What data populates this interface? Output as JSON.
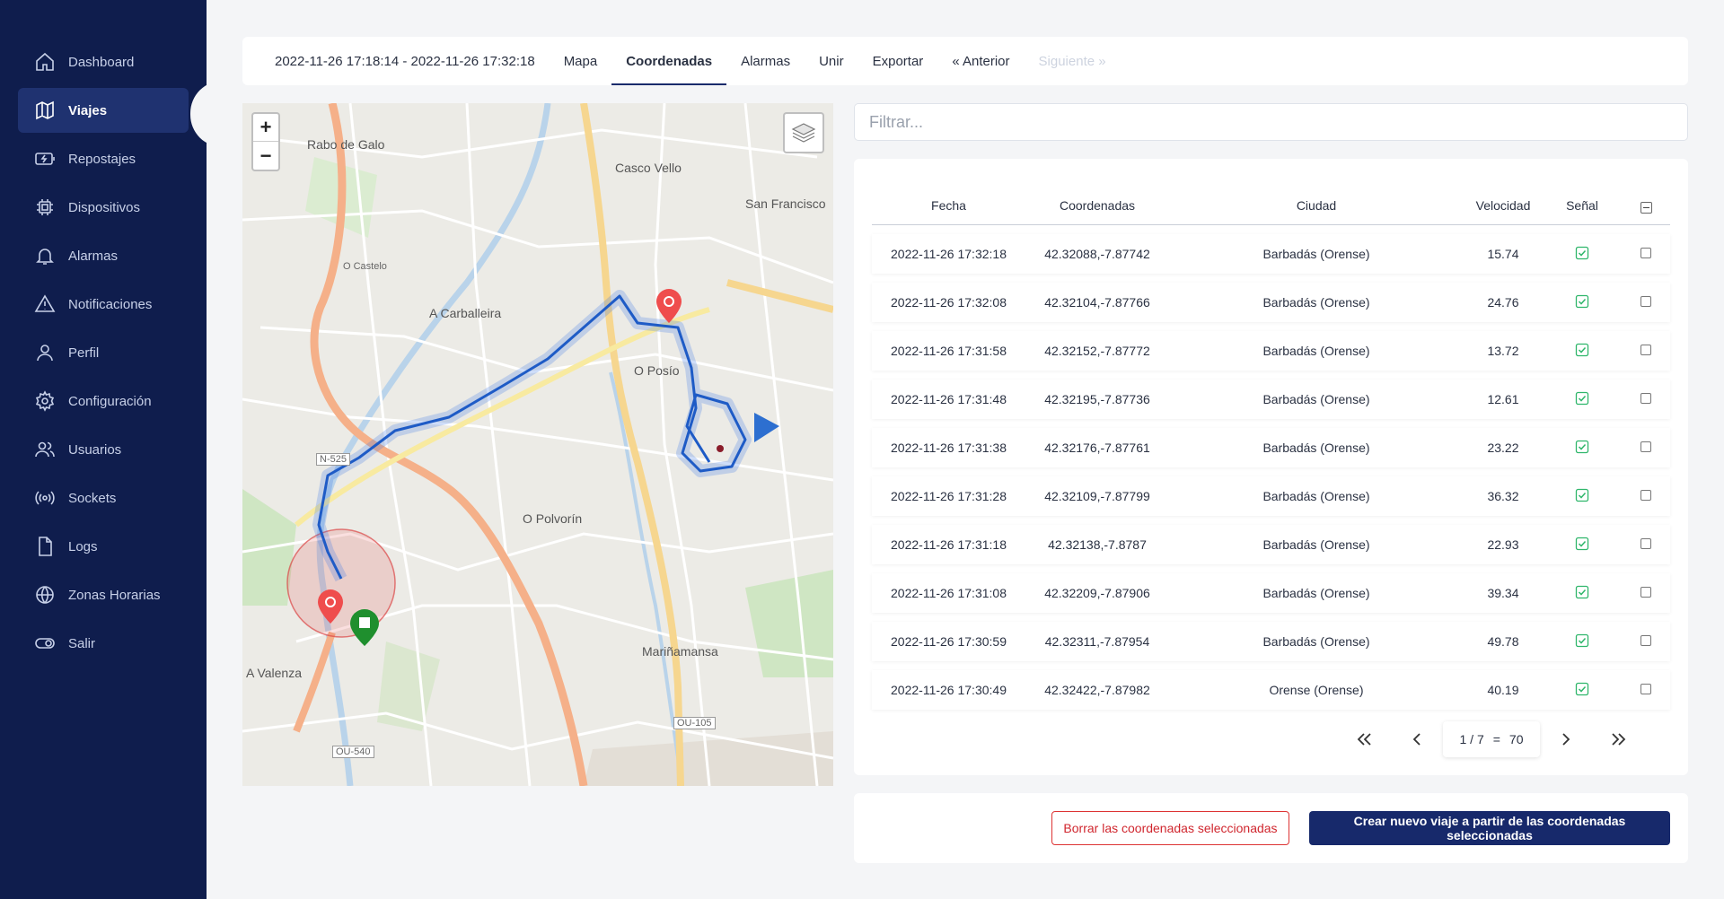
{
  "sidebar": {
    "items": [
      {
        "label": "Dashboard",
        "icon": "home-icon"
      },
      {
        "label": "Viajes",
        "icon": "map-icon",
        "active": true
      },
      {
        "label": "Repostajes",
        "icon": "battery-icon"
      },
      {
        "label": "Dispositivos",
        "icon": "chip-icon"
      },
      {
        "label": "Alarmas",
        "icon": "bell-icon"
      },
      {
        "label": "Notificaciones",
        "icon": "warning-icon"
      },
      {
        "label": "Perfil",
        "icon": "user-icon"
      },
      {
        "label": "Configuración",
        "icon": "gear-icon"
      },
      {
        "label": "Usuarios",
        "icon": "users-icon"
      },
      {
        "label": "Sockets",
        "icon": "broadcast-icon"
      },
      {
        "label": "Logs",
        "icon": "file-icon"
      },
      {
        "label": "Zonas Horarias",
        "icon": "globe-icon"
      },
      {
        "label": "Salir",
        "icon": "toggle-icon"
      }
    ]
  },
  "tabs": {
    "range": "2022-11-26 17:18:14 - 2022-11-26 17:32:18",
    "mapa": "Mapa",
    "coordenadas": "Coordenadas",
    "alarmas": "Alarmas",
    "unir": "Unir",
    "exportar": "Exportar",
    "anterior": "« Anterior",
    "siguiente": "Siguiente »"
  },
  "map": {
    "labels": {
      "rabo_de_galo": "Rabo de Galo",
      "casco_vello": "Casco Vello",
      "san_francisco": "San Francisco",
      "a_carballeira": "A Carballeira",
      "o_posio": "O Posío",
      "o_castelo": "O Castelo",
      "o_polvorin": "O Polvorín",
      "marinamansa": "Mariñamansa",
      "a_valenza": "A Valenza",
      "ou_105": "OU-105",
      "ou_540": "OU-540",
      "n_525": "N-525"
    },
    "zoom_in": "+",
    "zoom_out": "−"
  },
  "filter": {
    "placeholder": "Filtrar..."
  },
  "table": {
    "headers": {
      "fecha": "Fecha",
      "coordenadas": "Coordenadas",
      "ciudad": "Ciudad",
      "velocidad": "Velocidad",
      "senal": "Señal"
    },
    "rows": [
      {
        "fecha": "2022-11-26 17:32:18",
        "coord": "42.32088,-7.87742",
        "ciudad": "Barbadás (Orense)",
        "vel": "15.74"
      },
      {
        "fecha": "2022-11-26 17:32:08",
        "coord": "42.32104,-7.87766",
        "ciudad": "Barbadás (Orense)",
        "vel": "24.76"
      },
      {
        "fecha": "2022-11-26 17:31:58",
        "coord": "42.32152,-7.87772",
        "ciudad": "Barbadás (Orense)",
        "vel": "13.72"
      },
      {
        "fecha": "2022-11-26 17:31:48",
        "coord": "42.32195,-7.87736",
        "ciudad": "Barbadás (Orense)",
        "vel": "12.61"
      },
      {
        "fecha": "2022-11-26 17:31:38",
        "coord": "42.32176,-7.87761",
        "ciudad": "Barbadás (Orense)",
        "vel": "23.22"
      },
      {
        "fecha": "2022-11-26 17:31:28",
        "coord": "42.32109,-7.87799",
        "ciudad": "Barbadás (Orense)",
        "vel": "36.32"
      },
      {
        "fecha": "2022-11-26 17:31:18",
        "coord": "42.32138,-7.8787",
        "ciudad": "Barbadás (Orense)",
        "vel": "22.93"
      },
      {
        "fecha": "2022-11-26 17:31:08",
        "coord": "42.32209,-7.87906",
        "ciudad": "Barbadás (Orense)",
        "vel": "39.34"
      },
      {
        "fecha": "2022-11-26 17:30:59",
        "coord": "42.32311,-7.87954",
        "ciudad": "Barbadás (Orense)",
        "vel": "49.78"
      },
      {
        "fecha": "2022-11-26 17:30:49",
        "coord": "42.32422,-7.87982",
        "ciudad": "Orense (Orense)",
        "vel": "40.19"
      }
    ]
  },
  "pager": {
    "first": "«",
    "prev": "‹",
    "page": "1 / 7",
    "sep": "=",
    "total": "70",
    "next": "›",
    "last": "»"
  },
  "actions": {
    "delete": "Borrar las coordenadas seleccionadas",
    "create": "Crear nuevo viaje a partir de las coordenadas seleccionadas"
  },
  "colors": {
    "sidebar": "#0f1d4d",
    "accent": "#17296b",
    "danger": "#d0262e",
    "route": "#1e5bc6",
    "success": "#2fb66b"
  }
}
